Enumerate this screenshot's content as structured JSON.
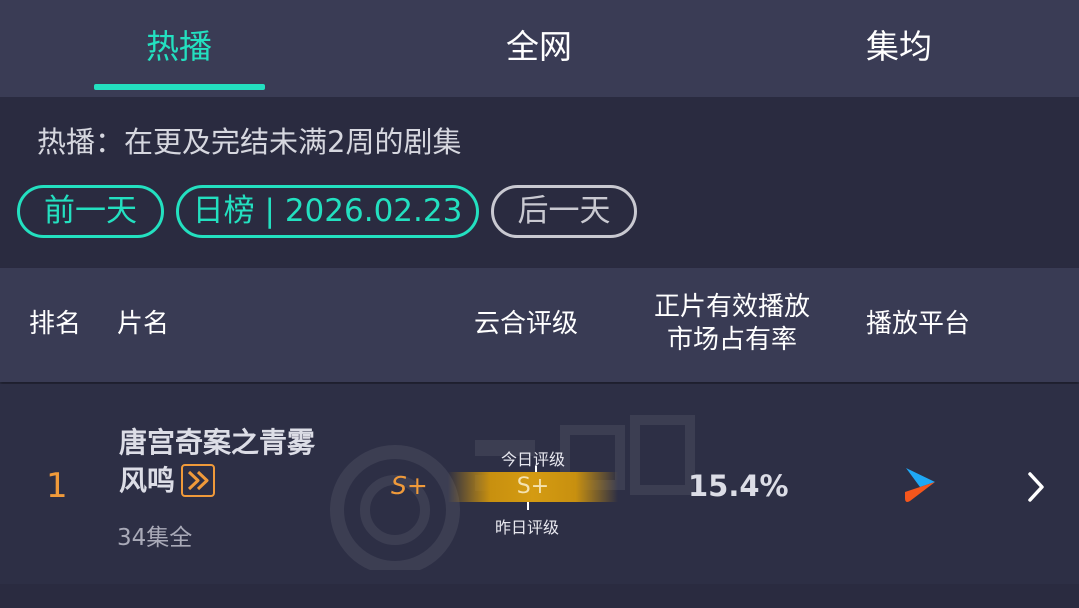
{
  "tabs": [
    {
      "label": "热播",
      "active": true
    },
    {
      "label": "全网",
      "active": false
    },
    {
      "label": "集均",
      "active": false
    }
  ],
  "filter": {
    "description": "热播：在更及完结未满2周的剧集",
    "prev_label": "前一天",
    "date_label": "日榜 | 2026.02.23",
    "next_label": "后一天"
  },
  "table": {
    "headers": {
      "rank": "排名",
      "title": "片名",
      "grade": "云合评级",
      "share_line1": "正片有效播放",
      "share_line2": "市场占有率",
      "platform": "播放平台"
    },
    "rows": [
      {
        "rank": "1",
        "title_line1": "唐宫奇案之青雾",
        "title_line2": "风鸣",
        "episodes": "34集全",
        "grade": "S+",
        "today_label": "今日评级",
        "bar_grade": "S+",
        "yesterday_label": "昨日评级",
        "share": "15.4%",
        "platform_icon": "youku-icon"
      }
    ]
  },
  "colors": {
    "accent": "#23e0c0",
    "orange": "#f09a3a",
    "background": "#2d2f45"
  }
}
